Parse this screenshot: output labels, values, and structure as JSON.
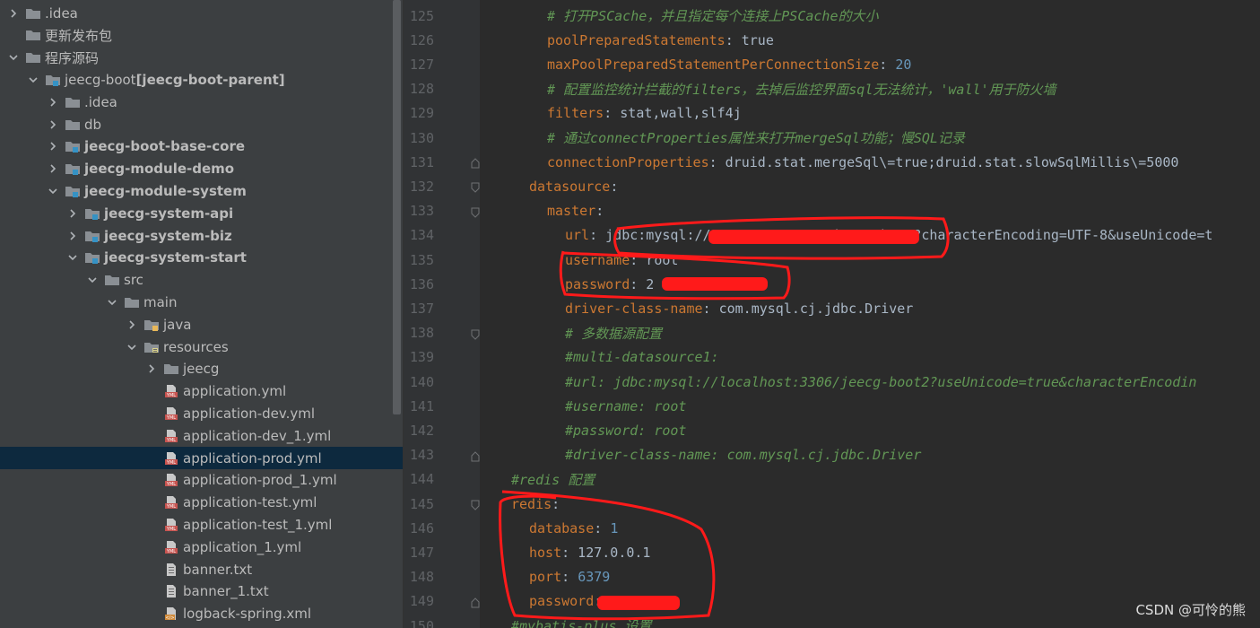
{
  "tree": {
    "items": [
      {
        "label": "jeecg-boot",
        "suffix": " [jeecg-boot-parent]"
      }
    ],
    "rows": [
      {
        "indent": 0,
        "arrow": "right",
        "icon": "folder",
        "label": ".idea",
        "bold": false
      },
      {
        "indent": 0,
        "arrow": "none",
        "icon": "folder",
        "label": "更新发布包",
        "bold": false
      },
      {
        "indent": 0,
        "arrow": "down",
        "icon": "folder",
        "label": "程序源码",
        "bold": false
      },
      {
        "indent": 1,
        "arrow": "down",
        "icon": "module",
        "label": "jeecg-boot",
        "suffix": " [jeecg-boot-parent]",
        "bold": false
      },
      {
        "indent": 2,
        "arrow": "right",
        "icon": "folder",
        "label": ".idea",
        "bold": false
      },
      {
        "indent": 2,
        "arrow": "right",
        "icon": "folder",
        "label": "db",
        "bold": false
      },
      {
        "indent": 2,
        "arrow": "right",
        "icon": "module",
        "label": "jeecg-boot-base-core",
        "bold": true
      },
      {
        "indent": 2,
        "arrow": "right",
        "icon": "module",
        "label": "jeecg-module-demo",
        "bold": true
      },
      {
        "indent": 2,
        "arrow": "down",
        "icon": "module",
        "label": "jeecg-module-system",
        "bold": true
      },
      {
        "indent": 3,
        "arrow": "right",
        "icon": "module",
        "label": "jeecg-system-api",
        "bold": true
      },
      {
        "indent": 3,
        "arrow": "right",
        "icon": "module",
        "label": "jeecg-system-biz",
        "bold": true
      },
      {
        "indent": 3,
        "arrow": "down",
        "icon": "module",
        "label": "jeecg-system-start",
        "bold": true
      },
      {
        "indent": 4,
        "arrow": "down",
        "icon": "folder",
        "label": "src",
        "bold": false
      },
      {
        "indent": 5,
        "arrow": "down",
        "icon": "folder",
        "label": "main",
        "bold": false
      },
      {
        "indent": 6,
        "arrow": "right",
        "icon": "src-folder",
        "label": "java",
        "bold": false
      },
      {
        "indent": 6,
        "arrow": "down",
        "icon": "res-folder",
        "label": "resources",
        "bold": false
      },
      {
        "indent": 7,
        "arrow": "right",
        "icon": "folder",
        "label": "jeecg",
        "bold": false
      },
      {
        "indent": 7,
        "arrow": "none",
        "icon": "yml",
        "label": "application.yml",
        "bold": false
      },
      {
        "indent": 7,
        "arrow": "none",
        "icon": "yml",
        "label": "application-dev.yml",
        "bold": false
      },
      {
        "indent": 7,
        "arrow": "none",
        "icon": "yml",
        "label": "application-dev_1.yml",
        "bold": false
      },
      {
        "indent": 7,
        "arrow": "none",
        "icon": "yml",
        "label": "application-prod.yml",
        "bold": false,
        "selected": true
      },
      {
        "indent": 7,
        "arrow": "none",
        "icon": "yml",
        "label": "application-prod_1.yml",
        "bold": false
      },
      {
        "indent": 7,
        "arrow": "none",
        "icon": "yml",
        "label": "application-test.yml",
        "bold": false
      },
      {
        "indent": 7,
        "arrow": "none",
        "icon": "yml",
        "label": "application-test_1.yml",
        "bold": false
      },
      {
        "indent": 7,
        "arrow": "none",
        "icon": "yml",
        "label": "application_1.yml",
        "bold": false
      },
      {
        "indent": 7,
        "arrow": "none",
        "icon": "txt",
        "label": "banner.txt",
        "bold": false
      },
      {
        "indent": 7,
        "arrow": "none",
        "icon": "txt",
        "label": "banner_1.txt",
        "bold": false
      },
      {
        "indent": 7,
        "arrow": "none",
        "icon": "xml",
        "label": "logback-spring.xml",
        "bold": false
      }
    ]
  },
  "editor": {
    "lines": [
      {
        "num": "125",
        "indent": 6,
        "tokens": [
          {
            "t": "c",
            "s": "# 打开PSCache，并且指定每个连接上PSCache的大小"
          }
        ]
      },
      {
        "num": "126",
        "indent": 6,
        "tokens": [
          {
            "t": "k",
            "s": "poolPreparedStatements"
          },
          {
            "t": "v",
            "s": ": true"
          }
        ]
      },
      {
        "num": "127",
        "indent": 6,
        "tokens": [
          {
            "t": "k",
            "s": "maxPoolPreparedStatementPerConnectionSize"
          },
          {
            "t": "v",
            "s": ": "
          },
          {
            "t": "n",
            "s": "20"
          }
        ]
      },
      {
        "num": "128",
        "indent": 6,
        "tokens": [
          {
            "t": "c",
            "s": "# 配置监控统计拦截的filters，去掉后监控界面sql无法统计，'wall'用于防火墙"
          }
        ]
      },
      {
        "num": "129",
        "indent": 6,
        "tokens": [
          {
            "t": "k",
            "s": "filters"
          },
          {
            "t": "v",
            "s": ": stat,wall,slf4j"
          }
        ]
      },
      {
        "num": "130",
        "indent": 6,
        "tokens": [
          {
            "t": "c",
            "s": "# 通过connectProperties属性来打开mergeSql功能；慢SQL记录"
          }
        ]
      },
      {
        "num": "131",
        "indent": 6,
        "tokens": [
          {
            "t": "k",
            "s": "connectionProperties"
          },
          {
            "t": "v",
            "s": ": druid.stat.mergeSql\\=true;druid.stat.slowSqlMillis\\=5000"
          }
        ],
        "fold": "end"
      },
      {
        "num": "132",
        "indent": 4,
        "tokens": [
          {
            "t": "k",
            "s": "datasource"
          },
          {
            "t": "v",
            "s": ":"
          }
        ],
        "fold": "start"
      },
      {
        "num": "133",
        "indent": 6,
        "tokens": [
          {
            "t": "k",
            "s": "master"
          },
          {
            "t": "v",
            "s": ":"
          }
        ],
        "fold": "start"
      },
      {
        "num": "134",
        "indent": 8,
        "tokens": [
          {
            "t": "k",
            "s": "url"
          },
          {
            "t": "v",
            "s": ": jdbc:mysql://127.0.0.1:3306/jeecg-boot?characterEncoding=UTF-8&useUnicode=t"
          }
        ]
      },
      {
        "num": "135",
        "indent": 8,
        "tokens": [
          {
            "t": "k",
            "s": "username"
          },
          {
            "t": "v",
            "s": ": root"
          }
        ]
      },
      {
        "num": "136",
        "indent": 8,
        "tokens": [
          {
            "t": "k",
            "s": "password"
          },
          {
            "t": "v",
            "s": ": 2"
          }
        ]
      },
      {
        "num": "137",
        "indent": 8,
        "tokens": [
          {
            "t": "k",
            "s": "driver-class-name"
          },
          {
            "t": "v",
            "s": ": com.mysql.cj.jdbc.Driver"
          }
        ]
      },
      {
        "num": "138",
        "indent": 8,
        "tokens": [
          {
            "t": "c",
            "s": "# 多数据源配置"
          }
        ],
        "fold": "start"
      },
      {
        "num": "139",
        "indent": 8,
        "tokens": [
          {
            "t": "c",
            "s": "#multi-datasource1:"
          }
        ]
      },
      {
        "num": "140",
        "indent": 8,
        "tokens": [
          {
            "t": "c",
            "s": "#url: jdbc:mysql://localhost:3306/jeecg-boot2?useUnicode=true&characterEncodin"
          }
        ]
      },
      {
        "num": "141",
        "indent": 8,
        "tokens": [
          {
            "t": "c",
            "s": "#username: root"
          }
        ]
      },
      {
        "num": "142",
        "indent": 8,
        "tokens": [
          {
            "t": "c",
            "s": "#password: root"
          }
        ]
      },
      {
        "num": "143",
        "indent": 8,
        "tokens": [
          {
            "t": "c",
            "s": "#driver-class-name: com.mysql.cj.jdbc.Driver"
          }
        ],
        "fold": "end"
      },
      {
        "num": "144",
        "indent": 2,
        "tokens": [
          {
            "t": "c",
            "s": "#redis 配置"
          }
        ]
      },
      {
        "num": "145",
        "indent": 2,
        "tokens": [
          {
            "t": "k",
            "s": "redis"
          },
          {
            "t": "v",
            "s": ":"
          }
        ],
        "fold": "start"
      },
      {
        "num": "146",
        "indent": 4,
        "tokens": [
          {
            "t": "k",
            "s": "database"
          },
          {
            "t": "v",
            "s": ": "
          },
          {
            "t": "n",
            "s": "1"
          }
        ]
      },
      {
        "num": "147",
        "indent": 4,
        "tokens": [
          {
            "t": "k",
            "s": "host"
          },
          {
            "t": "v",
            "s": ": 127.0.0.1"
          }
        ]
      },
      {
        "num": "148",
        "indent": 4,
        "tokens": [
          {
            "t": "k",
            "s": "port"
          },
          {
            "t": "v",
            "s": ": "
          },
          {
            "t": "n",
            "s": "6379"
          }
        ]
      },
      {
        "num": "149",
        "indent": 4,
        "tokens": [
          {
            "t": "k",
            "s": "password"
          },
          {
            "t": "v",
            "s": ":"
          }
        ],
        "fold": "end"
      },
      {
        "num": "150",
        "indent": 2,
        "tokens": [
          {
            "t": "c",
            "s": "#mybatis-plus 设置"
          }
        ]
      }
    ]
  },
  "watermark": "CSDN @可怜的熊",
  "colors": {
    "key": "#cc7832",
    "value": "#a9b7c6",
    "number": "#6897bb",
    "comment": "#629755",
    "markup": "#ff1a1a"
  }
}
